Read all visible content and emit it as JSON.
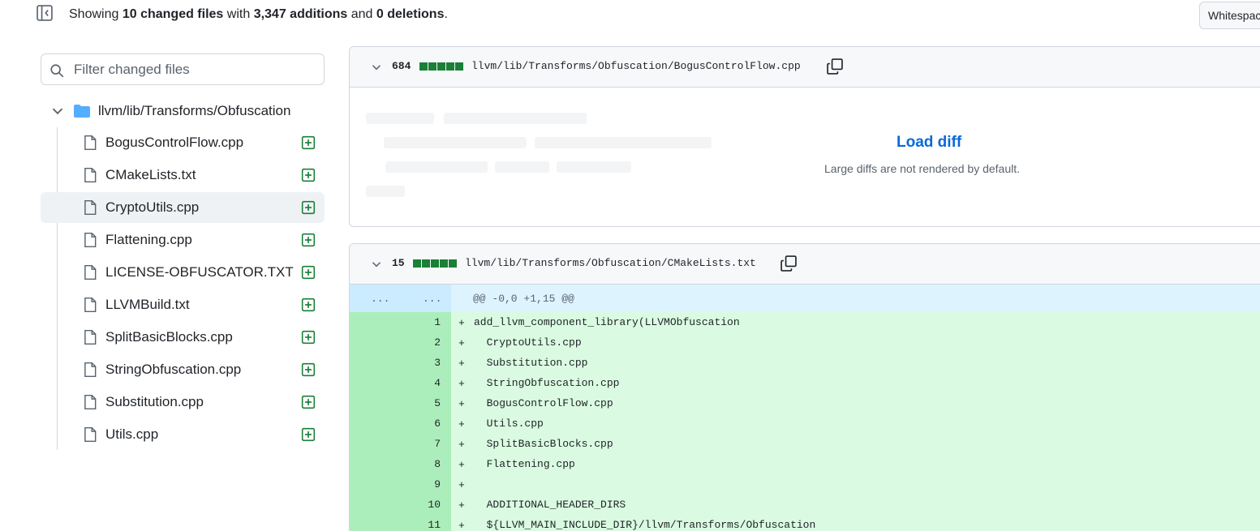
{
  "summary": {
    "prefix": "Showing",
    "changed_files": "10 changed files",
    "with": "with",
    "additions": "3,347 additions",
    "and": "and",
    "deletions": "0 deletions",
    "suffix": "."
  },
  "toolbar": {
    "whitespace_label": "Whitespace"
  },
  "file_tree": {
    "filter_placeholder": "Filter changed files",
    "directory": "llvm/lib/Transforms/Obfuscation",
    "selected": "CryptoUtils.cpp",
    "files": [
      "BogusControlFlow.cpp",
      "CMakeLists.txt",
      "CryptoUtils.cpp",
      "Flattening.cpp",
      "LICENSE-OBFUSCATOR.TXT",
      "LLVMBuild.txt",
      "SplitBasicBlocks.cpp",
      "StringObfuscation.cpp",
      "Substitution.cpp",
      "Utils.cpp"
    ]
  },
  "diffs": [
    {
      "count": "684",
      "path": "llvm/lib/Transforms/Obfuscation/BogusControlFlow.cpp",
      "load_label": "Load diff",
      "load_note": "Large diffs are not rendered by default."
    },
    {
      "count": "15",
      "path": "llvm/lib/Transforms/Obfuscation/CMakeLists.txt",
      "hunk": {
        "left": "...",
        "right": "...",
        "header": "@@ -0,0 +1,15 @@"
      },
      "lines": [
        {
          "n": "1",
          "sign": "+",
          "text": "add_llvm_component_library(LLVMObfuscation"
        },
        {
          "n": "2",
          "sign": "+",
          "text": "  CryptoUtils.cpp"
        },
        {
          "n": "3",
          "sign": "+",
          "text": "  Substitution.cpp"
        },
        {
          "n": "4",
          "sign": "+",
          "text": "  StringObfuscation.cpp"
        },
        {
          "n": "5",
          "sign": "+",
          "text": "  BogusControlFlow.cpp"
        },
        {
          "n": "6",
          "sign": "+",
          "text": "  Utils.cpp"
        },
        {
          "n": "7",
          "sign": "+",
          "text": "  SplitBasicBlocks.cpp"
        },
        {
          "n": "8",
          "sign": "+",
          "text": "  Flattening.cpp"
        },
        {
          "n": "9",
          "sign": "+",
          "text": ""
        },
        {
          "n": "10",
          "sign": "+",
          "text": "  ADDITIONAL_HEADER_DIRS"
        },
        {
          "n": "11",
          "sign": "+",
          "text": "  ${LLVM_MAIN_INCLUDE_DIR}/llvm/Transforms/Obfuscation"
        }
      ]
    }
  ],
  "colors": {
    "added_bg": "#dafbe1",
    "added_gutter": "#aceebb",
    "hunk_bg": "#ddf4ff",
    "diffstat_green": "#1a7f37",
    "link_blue": "#0969da",
    "folder_blue": "#54aeff"
  }
}
